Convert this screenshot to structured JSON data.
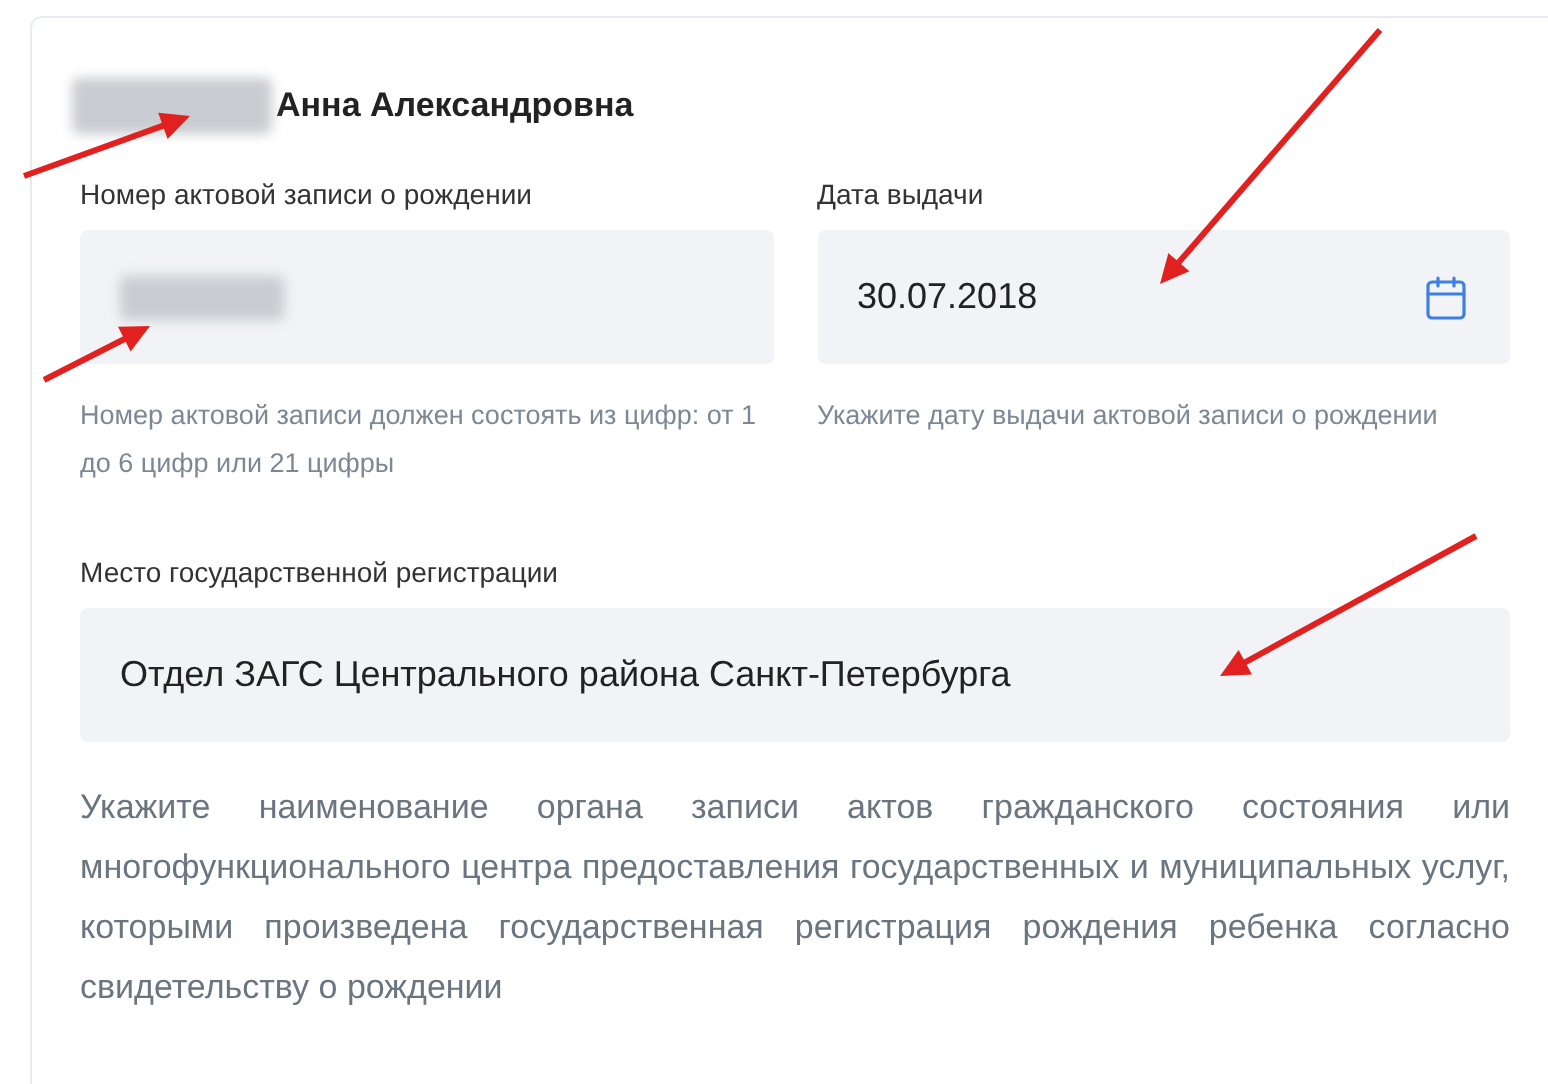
{
  "person": {
    "name_redacted": true,
    "name": "Анна Александровна"
  },
  "fields": [
    {
      "kind": "number",
      "label": "Номер актовой записи о рождении",
      "value_redacted": true,
      "hint": "Номер актовой записи должен состоять из цифр: от 1 до 6 цифр или 21 цифры"
    },
    {
      "kind": "date",
      "label": "Дата выдачи",
      "value": "30.07.2018",
      "value_redacted": false,
      "hint": "Укажите дату выдачи актовой записи о рождении"
    }
  ],
  "place": {
    "label": "Место государственной регистрации",
    "value": "Отдел ЗАГС Центрального района Санкт-Петербурга",
    "hint": "Укажите наименование органа записи актов гражданского состояния или многофункционального центра предоставления государственных и муниципальных услуг, которыми произведена государственная регистрация рождения ребенка согласно свидетельству о рождении"
  }
}
